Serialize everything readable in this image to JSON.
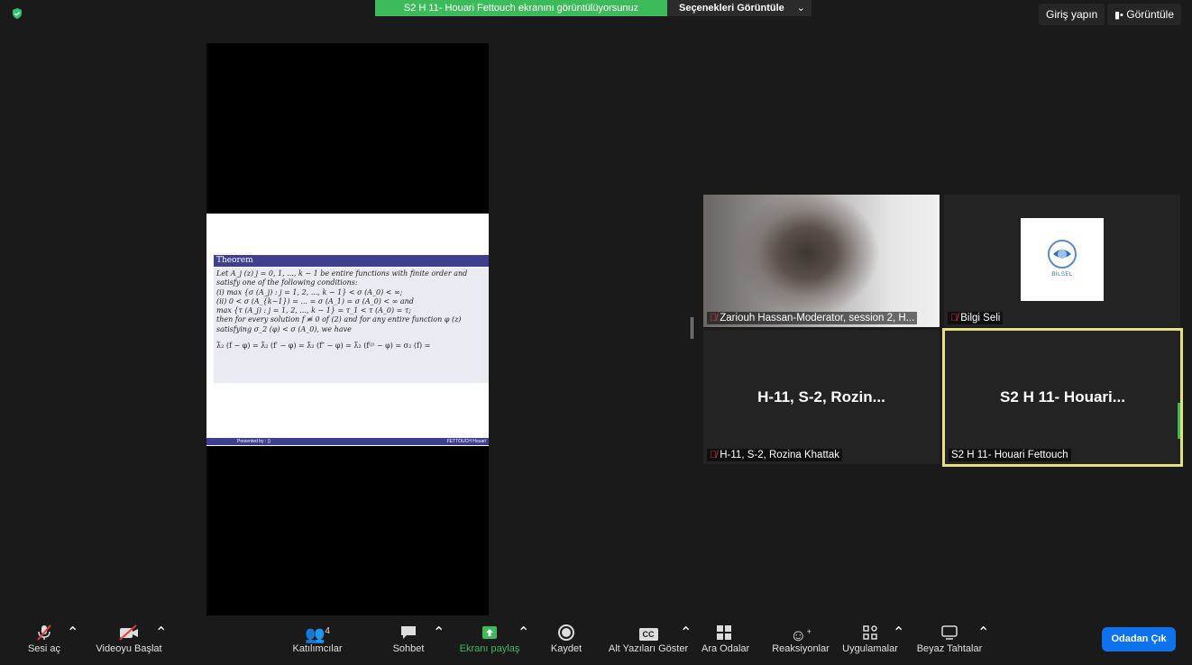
{
  "top_bar": {
    "sharing_banner": "S2 H 11- Houari Fettouch ekranını görüntülüyorsunuz",
    "view_options": "Seçenekleri Görüntüle",
    "sign_in": "Giriş yapın",
    "view": "Görüntüle"
  },
  "slide": {
    "title": "Theorem",
    "lines": [
      "Let A_j (z) j = 0, 1, ..., k − 1 be entire functions with finite order and",
      "satisfy one of the following conditions:",
      "(i) max {σ (A_j) : j = 1, 2, ..., k − 1} < σ (A_0) < ∞;",
      "(ii) 0 < σ (A_{k−1}) = ... = σ (A_1) = σ (A_0) < ∞ and",
      "max {τ (A_j) : j = 1, 2, ..., k − 1} = τ_1 < τ (A_0) = τ;",
      "then for every solution f ≢ 0 of (2) and for any entire function φ (z)",
      "satisfying σ_2 (φ) < σ (A_0), we have"
    ],
    "formula": "λ̄₂ (f − φ) = λ̄₂ (f′ − φ) = λ̄₂ (f″ − φ) = λ̄₂ (f⁽ʲ⁾ − φ) = σ₂ (f) =",
    "footer_left": "Presented by : ()",
    "footer_right": "FETTOUCH Houari"
  },
  "tiles": {
    "zariouh": {
      "name": "Zariouh Hassan-Moderator, session 2, H..."
    },
    "bilgi": {
      "name": "Bilgi Seli",
      "logo_text": "BİLSEL"
    },
    "rozina": {
      "center": "H-11, S-2, Rozin...",
      "name": "H-11, S-2, Rozina Khattak"
    },
    "houari": {
      "center": "S2 H 11- Houari...",
      "name": "S2 H 11- Houari Fettouch"
    }
  },
  "toolbar": {
    "unmute": "Sesi aç",
    "start_video": "Videoyu Başlat",
    "participants": "Katılımcılar",
    "participants_count": "4",
    "chat": "Sohbet",
    "share_screen": "Ekranı paylaş",
    "record": "Kaydet",
    "captions": "Alt Yazıları Göster",
    "captions_icon": "CC",
    "breakout": "Ara Odalar",
    "reactions": "Reaksiyonlar",
    "apps": "Uygulamalar",
    "whiteboards": "Beyaz Tahtalar",
    "leave": "Odadan Çık"
  },
  "colors": {
    "share_green": "#3dbb5a",
    "active_speaker_border": "#e5e17e",
    "leave_blue": "#0e72ed",
    "slide_header": "#3e3f8f"
  }
}
